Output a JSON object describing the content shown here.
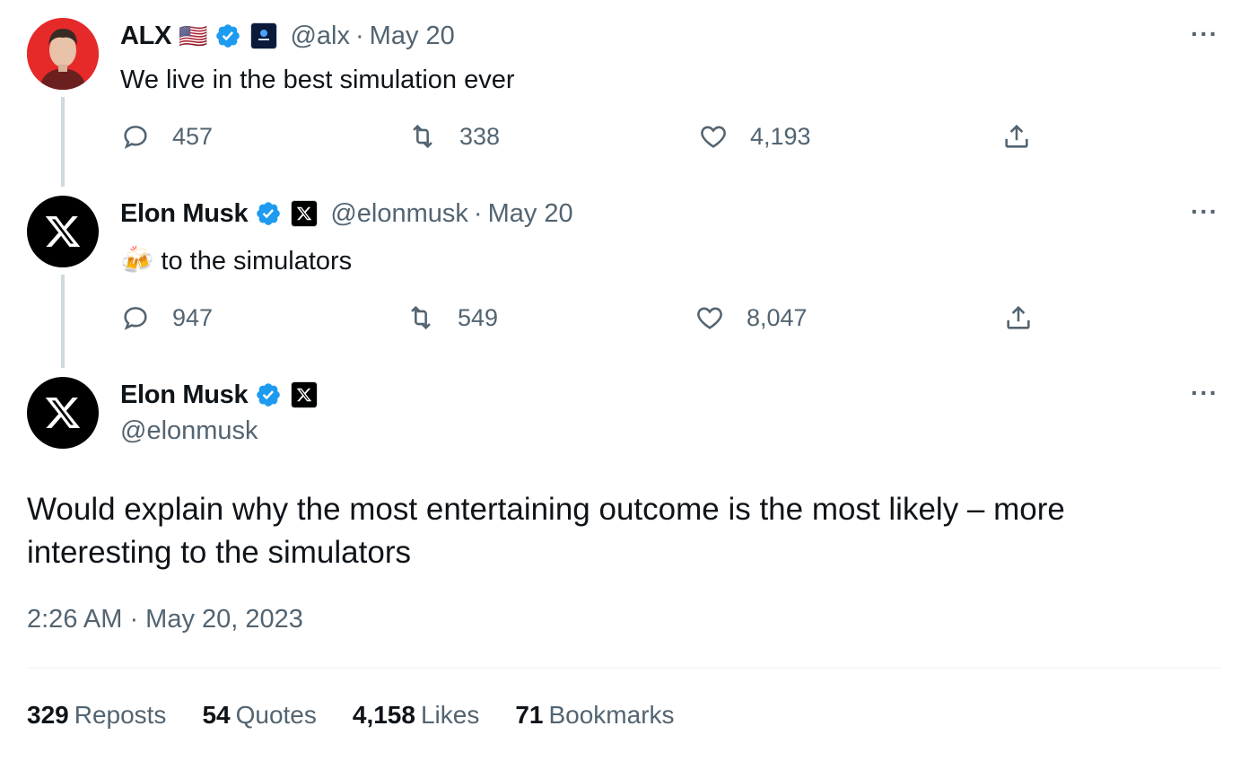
{
  "tweets": [
    {
      "name": "ALX",
      "flag": "🇺🇸",
      "handle": "@alx",
      "sep": "·",
      "date": "May 20",
      "text": "We live in the best simulation ever",
      "replies": "457",
      "reposts": "338",
      "likes": "4,193",
      "more": "···"
    },
    {
      "name": "Elon Musk",
      "handle": "@elonmusk",
      "sep": "·",
      "date": "May 20",
      "emoji": "🍻",
      "text": "to the simulators",
      "replies": "947",
      "reposts": "549",
      "likes": "8,047",
      "more": "···"
    }
  ],
  "main": {
    "name": "Elon Musk",
    "handle": "@elonmusk",
    "more": "···",
    "text": "Would explain why the most entertaining outcome is the most likely – more interesting to the simulators",
    "timestamp": "2:26 AM · May 20, 2023",
    "stats": [
      {
        "value": "329",
        "label": "Reposts"
      },
      {
        "value": "54",
        "label": "Quotes"
      },
      {
        "value": "4,158",
        "label": "Likes"
      },
      {
        "value": "71",
        "label": "Bookmarks"
      }
    ]
  },
  "colors": {
    "verified": "#1d9bf0",
    "secondary_text": "#536471",
    "thread_line": "#cfd9de"
  },
  "icons": [
    "reply-icon",
    "repost-icon",
    "like-icon",
    "share-icon",
    "verified-badge-icon",
    "x-logo-icon",
    "more-icon"
  ]
}
